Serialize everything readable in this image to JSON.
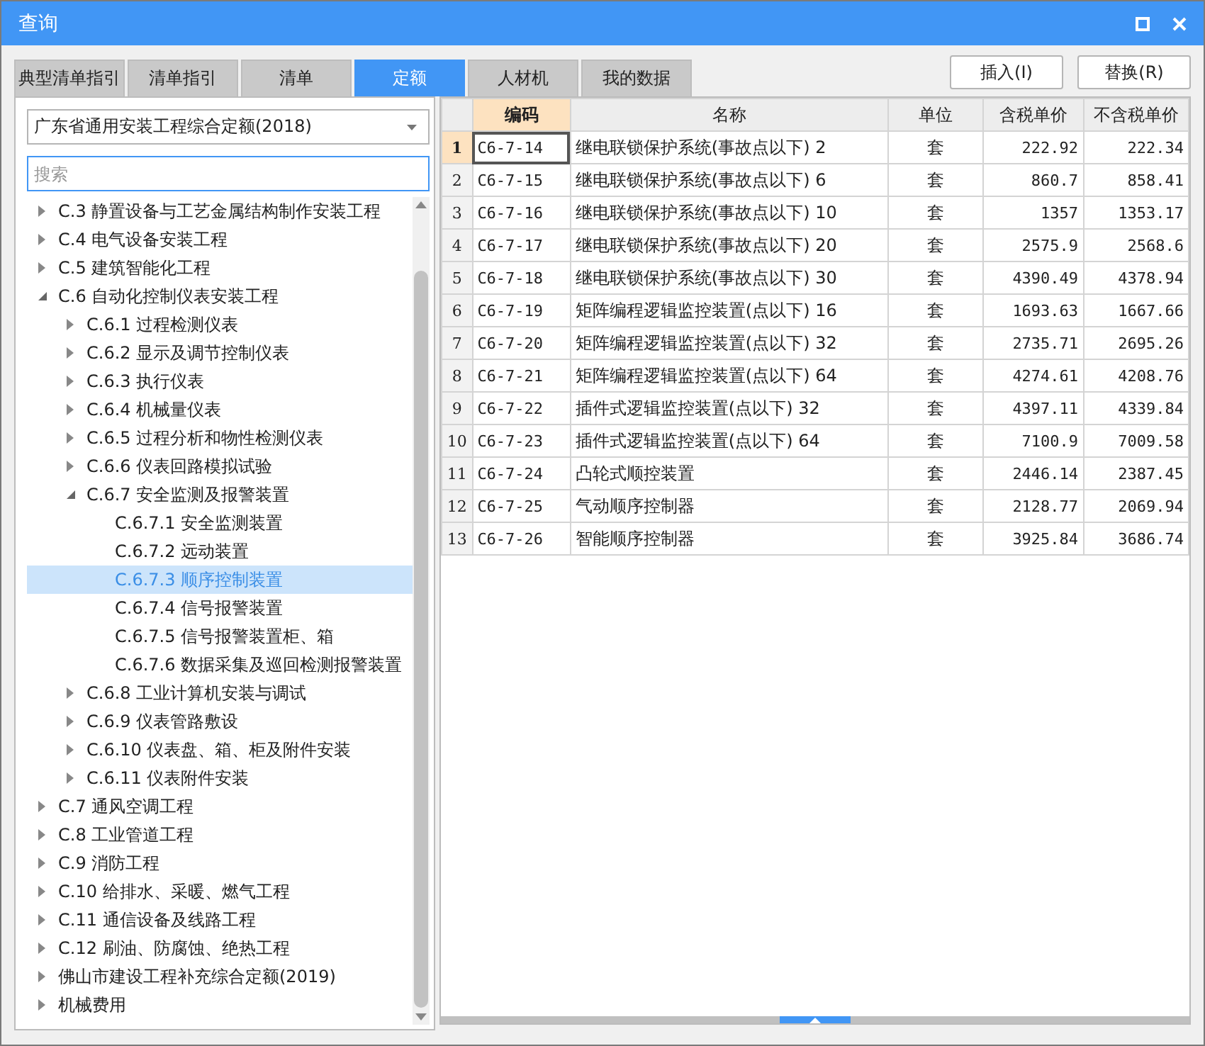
{
  "window": {
    "title": "查询"
  },
  "tabs": [
    {
      "label": "典型清单指引",
      "selected": false
    },
    {
      "label": "清单指引",
      "selected": false
    },
    {
      "label": "清单",
      "selected": false
    },
    {
      "label": "定额",
      "selected": true
    },
    {
      "label": "人材机",
      "selected": false
    },
    {
      "label": "我的数据",
      "selected": false
    }
  ],
  "buttons": [
    {
      "label": "插入(I)"
    },
    {
      "label": "替换(R)"
    }
  ],
  "library": {
    "value": "广东省通用安装工程综合定额(2018)"
  },
  "search": {
    "placeholder": "搜索"
  },
  "tree": [
    {
      "label": "C.3 静置设备与工艺金属结构制作安装工程",
      "kind": "folder",
      "expanded": false,
      "selected": false
    },
    {
      "label": "C.4 电气设备安装工程",
      "kind": "folder",
      "expanded": false,
      "selected": false
    },
    {
      "label": "C.5 建筑智能化工程",
      "kind": "folder",
      "expanded": false,
      "selected": false
    },
    {
      "label": "C.6 自动化控制仪表安装工程",
      "kind": "folder",
      "expanded": true,
      "selected": false,
      "children": [
        {
          "label": "C.6.1 过程检测仪表",
          "kind": "folder",
          "expanded": false,
          "selected": false
        },
        {
          "label": "C.6.2 显示及调节控制仪表",
          "kind": "folder",
          "expanded": false,
          "selected": false
        },
        {
          "label": "C.6.3 执行仪表",
          "kind": "folder",
          "expanded": false,
          "selected": false
        },
        {
          "label": "C.6.4 机械量仪表",
          "kind": "folder",
          "expanded": false,
          "selected": false
        },
        {
          "label": "C.6.5 过程分析和物性检测仪表",
          "kind": "folder",
          "expanded": false,
          "selected": false
        },
        {
          "label": "C.6.6 仪表回路模拟试验",
          "kind": "folder",
          "expanded": false,
          "selected": false
        },
        {
          "label": "C.6.7 安全监测及报警装置",
          "kind": "folder",
          "expanded": true,
          "selected": false,
          "children": [
            {
              "label": "C.6.7.1 安全监测装置",
              "kind": "leaf",
              "selected": false
            },
            {
              "label": "C.6.7.2 远动装置",
              "kind": "leaf",
              "selected": false
            },
            {
              "label": "C.6.7.3 顺序控制装置",
              "kind": "leaf",
              "selected": true
            },
            {
              "label": "C.6.7.4 信号报警装置",
              "kind": "leaf",
              "selected": false
            },
            {
              "label": "C.6.7.5 信号报警装置柜、箱",
              "kind": "leaf",
              "selected": false
            },
            {
              "label": "C.6.7.6 数据采集及巡回检测报警装置",
              "kind": "leaf",
              "selected": false
            }
          ]
        },
        {
          "label": "C.6.8 工业计算机安装与调试",
          "kind": "folder",
          "expanded": false,
          "selected": false
        },
        {
          "label": "C.6.9 仪表管路敷设",
          "kind": "folder",
          "expanded": false,
          "selected": false
        },
        {
          "label": "C.6.10 仪表盘、箱、柜及附件安装",
          "kind": "folder",
          "expanded": false,
          "selected": false
        },
        {
          "label": "C.6.11 仪表附件安装",
          "kind": "folder",
          "expanded": false,
          "selected": false
        }
      ]
    },
    {
      "label": "C.7 通风空调工程",
      "kind": "folder",
      "expanded": false,
      "selected": false
    },
    {
      "label": "C.8 工业管道工程",
      "kind": "folder",
      "expanded": false,
      "selected": false
    },
    {
      "label": "C.9 消防工程",
      "kind": "folder",
      "expanded": false,
      "selected": false
    },
    {
      "label": "C.10 给排水、采暖、燃气工程",
      "kind": "folder",
      "expanded": false,
      "selected": false
    },
    {
      "label": "C.11 通信设备及线路工程",
      "kind": "folder",
      "expanded": false,
      "selected": false
    },
    {
      "label": "C.12 刷油、防腐蚀、绝热工程",
      "kind": "folder",
      "expanded": false,
      "selected": false
    },
    {
      "label": "佛山市建设工程补充综合定额(2019)",
      "kind": "folder",
      "expanded": false,
      "selected": false
    },
    {
      "label": "机械费用",
      "kind": "folder",
      "expanded": false,
      "selected": false
    }
  ],
  "table": {
    "columns": [
      {
        "label": "编码",
        "selected": true
      },
      {
        "label": "名称",
        "selected": false
      },
      {
        "label": "单位",
        "selected": false
      },
      {
        "label": "含税单价",
        "selected": false
      },
      {
        "label": "不含税单价",
        "selected": false
      }
    ],
    "rows": [
      {
        "number": "1",
        "selected": true,
        "cells": [
          "C6-7-14",
          "继电联锁保护系统(事故点以下) 2",
          "套",
          "222.92",
          "222.34"
        ]
      },
      {
        "number": "2",
        "selected": false,
        "cells": [
          "C6-7-15",
          "继电联锁保护系统(事故点以下) 6",
          "套",
          "860.7",
          "858.41"
        ]
      },
      {
        "number": "3",
        "selected": false,
        "cells": [
          "C6-7-16",
          "继电联锁保护系统(事故点以下) 10",
          "套",
          "1357",
          "1353.17"
        ]
      },
      {
        "number": "4",
        "selected": false,
        "cells": [
          "C6-7-17",
          "继电联锁保护系统(事故点以下) 20",
          "套",
          "2575.9",
          "2568.6"
        ]
      },
      {
        "number": "5",
        "selected": false,
        "cells": [
          "C6-7-18",
          "继电联锁保护系统(事故点以下) 30",
          "套",
          "4390.49",
          "4378.94"
        ]
      },
      {
        "number": "6",
        "selected": false,
        "cells": [
          "C6-7-19",
          "矩阵编程逻辑监控装置(点以下) 16",
          "套",
          "1693.63",
          "1667.66"
        ]
      },
      {
        "number": "7",
        "selected": false,
        "cells": [
          "C6-7-20",
          "矩阵编程逻辑监控装置(点以下) 32",
          "套",
          "2735.71",
          "2695.26"
        ]
      },
      {
        "number": "8",
        "selected": false,
        "cells": [
          "C6-7-21",
          "矩阵编程逻辑监控装置(点以下) 64",
          "套",
          "4274.61",
          "4208.76"
        ]
      },
      {
        "number": "9",
        "selected": false,
        "cells": [
          "C6-7-22",
          "插件式逻辑监控装置(点以下) 32",
          "套",
          "4397.11",
          "4339.84"
        ]
      },
      {
        "number": "10",
        "selected": false,
        "cells": [
          "C6-7-23",
          "插件式逻辑监控装置(点以下) 64",
          "套",
          "7100.9",
          "7009.58"
        ]
      },
      {
        "number": "11",
        "selected": false,
        "cells": [
          "C6-7-24",
          "凸轮式顺控装置",
          "套",
          "2446.14",
          "2387.45"
        ]
      },
      {
        "number": "12",
        "selected": false,
        "cells": [
          "C6-7-25",
          "气动顺序控制器",
          "套",
          "2128.77",
          "2069.94"
        ]
      },
      {
        "number": "13",
        "selected": false,
        "cells": [
          "C6-7-26",
          "智能顺序控制器",
          "套",
          "3925.84",
          "3686.74"
        ]
      }
    ]
  }
}
